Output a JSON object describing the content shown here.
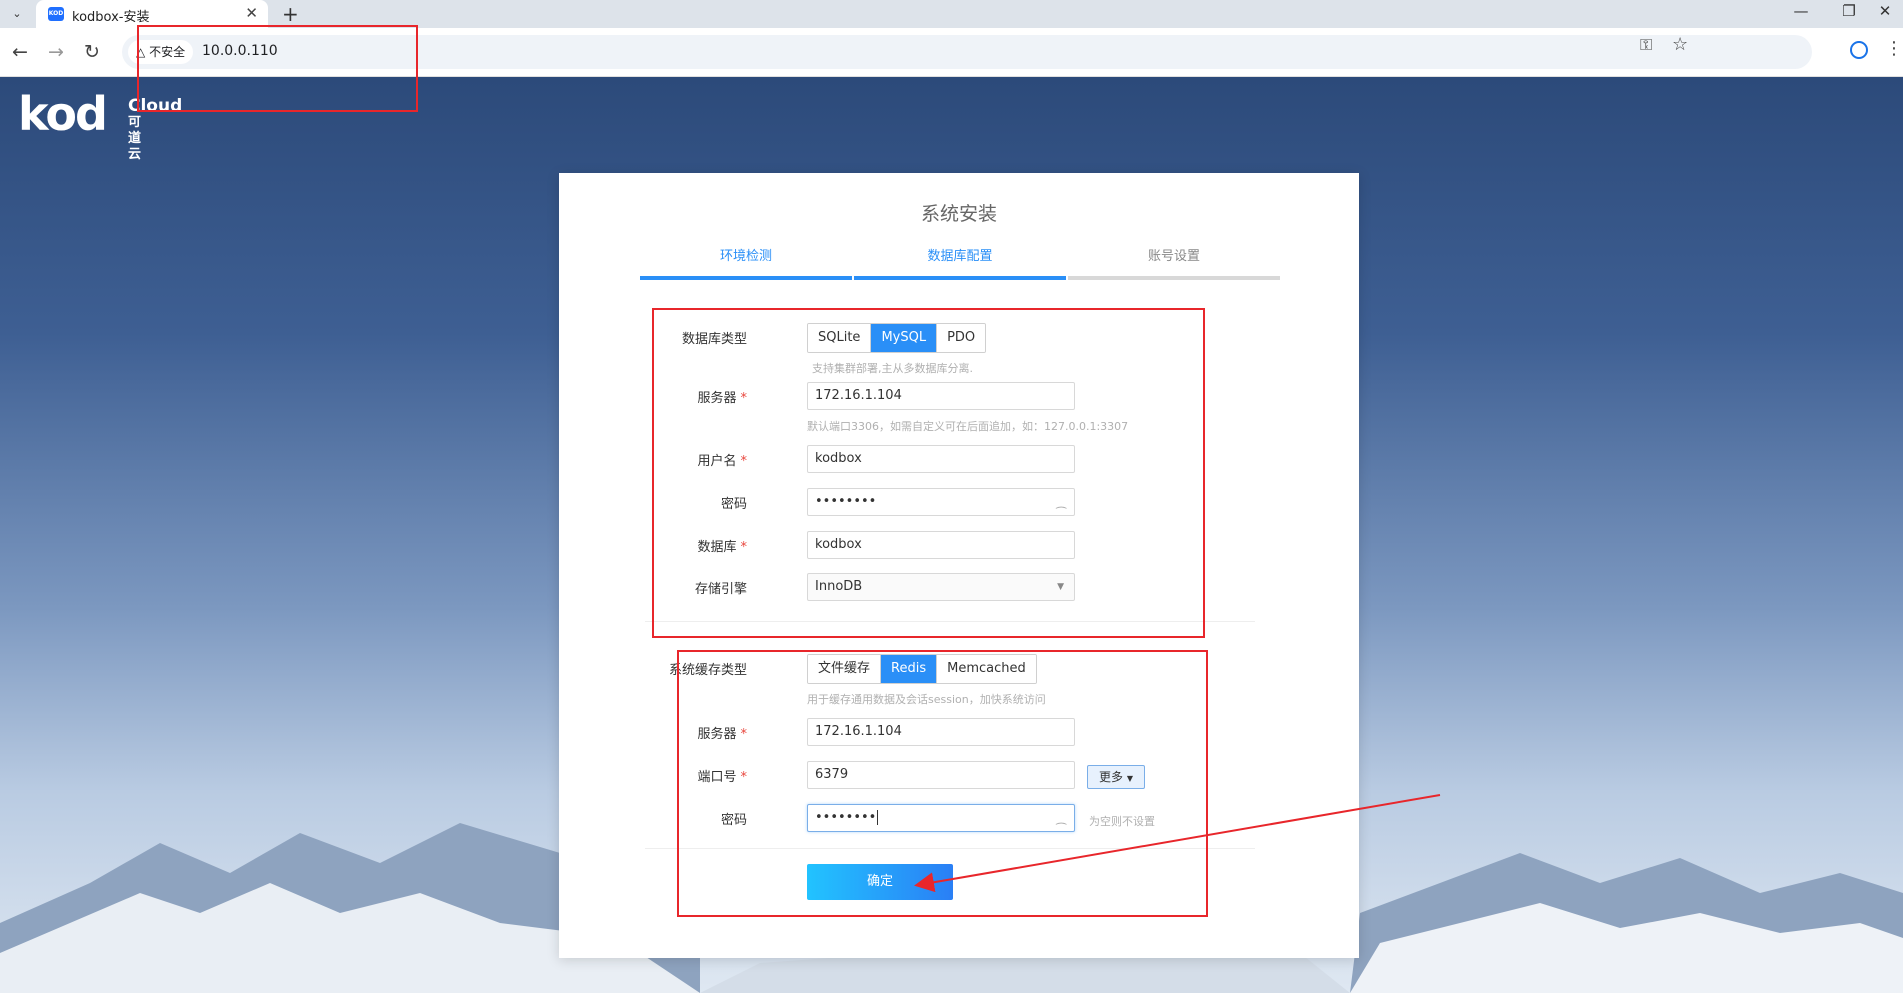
{
  "browser": {
    "tab_title": "kodbox-安装",
    "favicon_text": "KOD",
    "security_label": "不安全",
    "url": "10.0.0.110"
  },
  "logo": {
    "main": "kod",
    "cloud": "Cloud",
    "cn": "可道云"
  },
  "panel": {
    "title": "系统安装",
    "steps": [
      {
        "label": "环境检测",
        "active": true
      },
      {
        "label": "数据库配置",
        "active": true
      },
      {
        "label": "账号设置",
        "active": false
      }
    ]
  },
  "database": {
    "type_label": "数据库类型",
    "types": [
      "SQLite",
      "MySQL",
      "PDO"
    ],
    "selected_type": "MySQL",
    "type_hint": "支持集群部署,主从多数据库分离.",
    "server_label": "服务器",
    "server_value": "172.16.1.104",
    "server_hint": "默认端口3306，如需自定义可在后面追加，如：127.0.0.1:3307",
    "user_label": "用户名",
    "user_value": "kodbox",
    "password_label": "密码",
    "password_value": "••••••••",
    "dbname_label": "数据库",
    "dbname_value": "kodbox",
    "engine_label": "存储引擎",
    "engine_value": "InnoDB"
  },
  "cache": {
    "type_label": "系统缓存类型",
    "types": [
      "文件缓存",
      "Redis",
      "Memcached"
    ],
    "selected_type": "Redis",
    "type_hint": "用于缓存通用数据及会话session，加快系统访问",
    "server_label": "服务器",
    "server_value": "172.16.1.104",
    "port_label": "端口号",
    "port_value": "6379",
    "more_label": "更多",
    "password_label": "密码",
    "password_value": "••••••••",
    "password_hint": "为空则不设置",
    "submit_label": "确定"
  },
  "required_mark": "*",
  "icons": {
    "back": "arrow-left-icon",
    "forward": "arrow-right-icon",
    "reload": "reload-icon",
    "key": "key-icon",
    "star": "star-icon",
    "profile": "profile-icon",
    "menu": "vertical-dots-icon",
    "eye": "eye-closed-icon",
    "caret": "caret-down-icon"
  },
  "colors": {
    "accent": "#2a8ff7",
    "annotation": "#e8262b",
    "required": "#e8453c"
  }
}
